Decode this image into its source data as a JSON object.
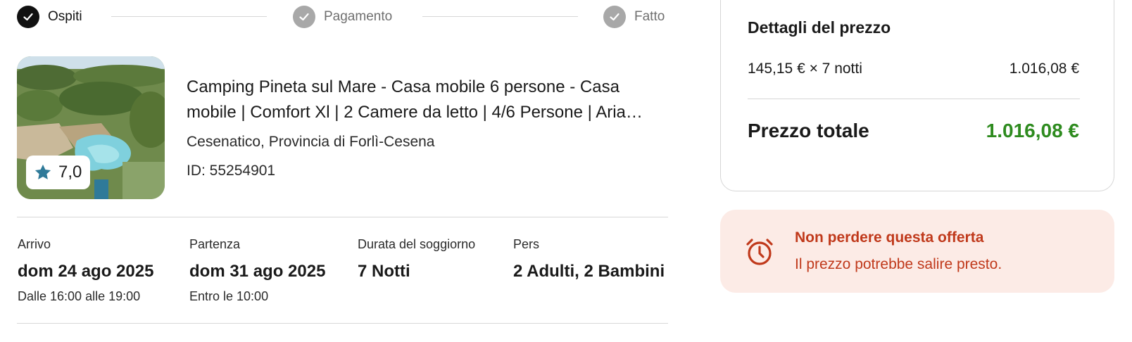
{
  "stepper": {
    "steps": [
      {
        "label": "Ospiti",
        "state": "active"
      },
      {
        "label": "Pagamento",
        "state": "completed"
      },
      {
        "label": "Fatto",
        "state": "completed"
      }
    ]
  },
  "property": {
    "title": "Camping Pineta sul Mare - Casa mobile 6 persone - Casa mobile | Comfort Xl | 2 Camere da letto | 4/6 Persone | Aria condizionata",
    "location": "Cesenatico, Provincia di Forlì-Cesena",
    "id_text": "ID: 55254901",
    "rating": "7,0",
    "rating_icon": "star-icon"
  },
  "stay": {
    "checkin": {
      "label": "Arrivo",
      "value": "dom 24 ago 2025",
      "sub": "Dalle 16:00 alle 19:00"
    },
    "checkout": {
      "label": "Partenza",
      "value": "dom 31 ago 2025",
      "sub": "Entro le 10:00"
    },
    "duration": {
      "label": "Durata del soggiorno",
      "value": "7 Notti"
    },
    "guests": {
      "label": "Pers",
      "value": "2 Adulti, 2 Bambini"
    }
  },
  "price": {
    "title": "Dettagli del prezzo",
    "nightly_line": "145,15 € × 7 notti",
    "nightly_amount": "1.016,08 €",
    "total_label": "Prezzo totale",
    "total_value": "1.016,08 €"
  },
  "alert": {
    "title": "Non perdere questa offerta",
    "text": "Il prezzo potrebbe salire presto.",
    "icon": "alarm-clock-icon"
  },
  "colors": {
    "accent_green": "#2e8b1f",
    "alert_red": "#c0391b",
    "alert_bg": "#fcebe6",
    "star_blue": "#2f7a99"
  }
}
